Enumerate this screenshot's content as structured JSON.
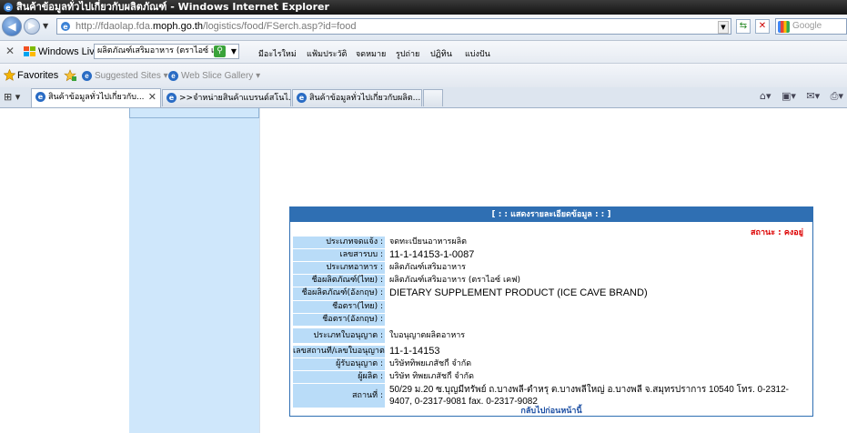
{
  "window": {
    "title": "สินค้าข้อมูลทั่วไปเกี่ยวกับผลิตภัณฑ์ - Windows Internet Explorer"
  },
  "address": {
    "url_prefix": "http://fdaolap.fda.",
    "url_domain": "moph.go.th",
    "url_path": "/logistics/food/FSerch.asp?id=food"
  },
  "search": {
    "placeholder": "Google"
  },
  "links_bar": {
    "windows_live": "Windows Live",
    "search_value": "ผลิตภัณฑ์เสริมอาหาร (ตราไอซ์ เค",
    "items": [
      "มีอะไรใหม่",
      "แฟ้มประวัติ",
      "จดหมาย",
      "รูปถ่าย",
      "ปฏิทิน",
      "แบ่งปัน"
    ]
  },
  "favorites_bar": {
    "favorites": "Favorites",
    "suggested": "Suggested Sites ▾",
    "webslice": "Web Slice Gallery ▾"
  },
  "tabs": [
    {
      "label": "สินค้าข้อมูลทั่วไปเกี่ยวกับ..."
    },
    {
      "label": ">>จำหน่ายสินค้าแบรนด์สโนไ..."
    },
    {
      "label": "สินค้าข้อมูลทั่วไปเกี่ยวกับผลิต..."
    }
  ],
  "detail": {
    "header": "[ : : แสดงรายละเอียดข้อมูล : : ]",
    "status": "สถานะ : คงอยู่",
    "rows": [
      {
        "label": "ประเภทจดแจ้ง :",
        "value": "จดทะเบียนอาหารผลิต"
      },
      {
        "label": "เลขสารบบ :",
        "value": "11-1-14153-1-0087"
      },
      {
        "label": "ประเภทอาหาร :",
        "value": "ผลิตภัณฑ์เสริมอาหาร"
      },
      {
        "label": "ชื่อผลิตภัณฑ์(ไทย) :",
        "value": "ผลิตภัณฑ์เสริมอาหาร (ตราไอซ์ เคฟ)"
      },
      {
        "label": "ชื่อผลิตภัณฑ์(อังกฤษ) :",
        "value": "DIETARY SUPPLEMENT PRODUCT (ICE CAVE BRAND)"
      },
      {
        "label": "ชื่อตรา(ไทย) :",
        "value": ""
      },
      {
        "label": "ชื่อตรา(อังกฤษ) :",
        "value": ""
      },
      {
        "label": "ประเภทใบอนุญาต :",
        "value": "ใบอนุญาตผลิตอาหาร"
      },
      {
        "label": "เลขสถานที่/เลขใบอนุญาต :",
        "value": "11-1-14153"
      },
      {
        "label": "ผู้รับอนุญาต :",
        "value": "บริษัททิพยเภสัชกี้ จำกัด"
      },
      {
        "label": "ผู้ผลิต :",
        "value": "บริษัท ทิพยเภสัชกี้ จำกัด"
      },
      {
        "label": "สถานที่ :",
        "value": "50/29 ม.20 ซ.บุญมีทรัพย์ ถ.บางพลี-ตำหรุ ต.บางพลีใหญ่ อ.บางพลี จ.สมุทรปราการ 10540 โทร. 0-2312-9407, 0-2317-9081 fax. 0-2317-9082"
      }
    ],
    "back_link": "กลับไปก่อนหน้านี้"
  }
}
